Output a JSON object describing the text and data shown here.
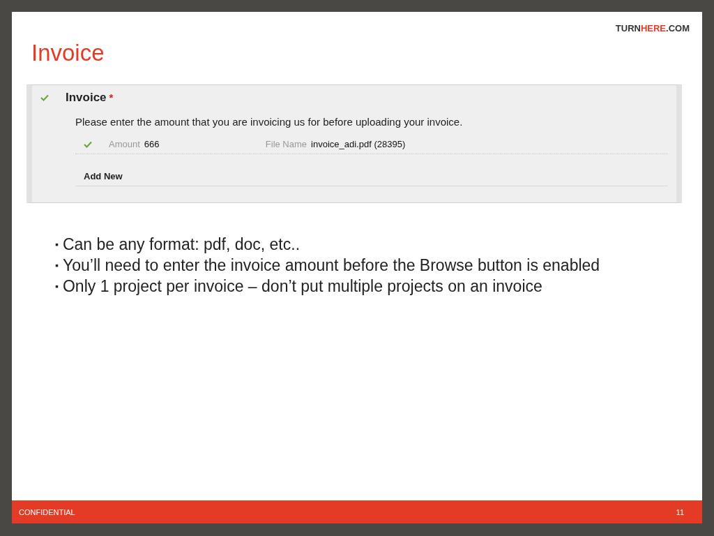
{
  "slide": {
    "title": "Invoice",
    "logo": [
      {
        "text": "TURN",
        "color": "#333333"
      },
      {
        "text": "HERE",
        "color": "#e33b26"
      },
      {
        "text": ".COM",
        "color": "#333333"
      }
    ]
  },
  "form": {
    "heading": "Invoice",
    "required_mark": "*",
    "complete": true,
    "instructions": "Please enter the amount that you are invoicing us for before uploading your invoice.",
    "rows": [
      {
        "complete": true,
        "amount_label": "Amount",
        "amount": "666",
        "file_label": "File Name",
        "file": "invoice_adi.pdf (28395)"
      }
    ],
    "add_new": "Add New"
  },
  "bullets": [
    "Can be any format: pdf, doc, etc..",
    "You’ll need to enter the invoice amount before the Browse button is enabled",
    "Only 1 project per invoice – don’t put multiple projects on an invoice"
  ],
  "bullet_mark": "▪",
  "footer": {
    "label": "CONFIDENTIAL",
    "page": "11"
  }
}
